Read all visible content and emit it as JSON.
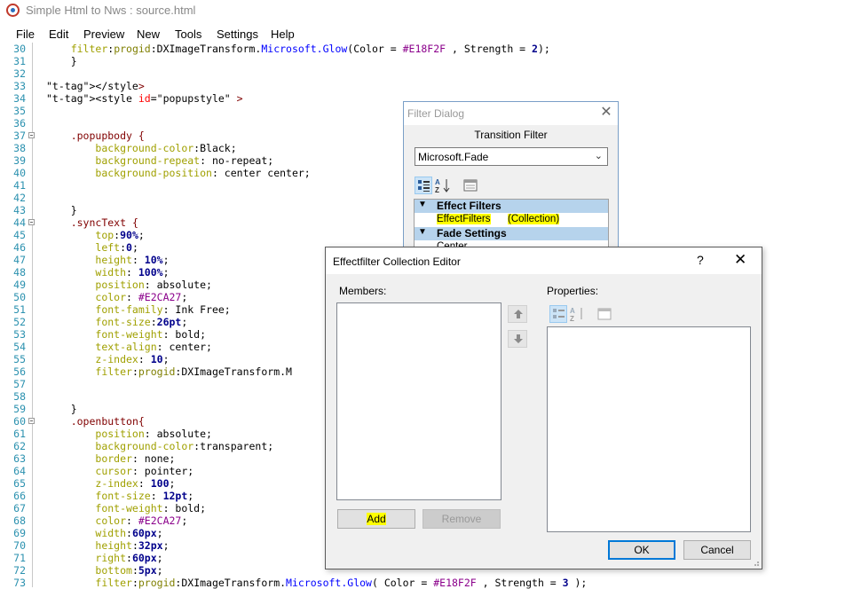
{
  "window": {
    "title": "Simple Html to Nws : source.html"
  },
  "menu": [
    {
      "label": "File"
    },
    {
      "label": "Edit"
    },
    {
      "label": "Preview"
    },
    {
      "label": "New"
    },
    {
      "label": "Tools"
    },
    {
      "label": "Settings"
    },
    {
      "label": "Help"
    }
  ],
  "editor": {
    "lines": [
      {
        "n": "30",
        "t": "    filter:progid:DXImageTransform.Microsoft.Glow(Color = #E18F2F , Strength = 2);"
      },
      {
        "n": "31",
        "t": "    }"
      },
      {
        "n": "32",
        "t": ""
      },
      {
        "n": "33",
        "t": "</style>"
      },
      {
        "n": "34",
        "t": "<style id=\"popupstyle\" >"
      },
      {
        "n": "35",
        "t": ""
      },
      {
        "n": "36",
        "t": ""
      },
      {
        "n": "37",
        "t": "    .popupbody {"
      },
      {
        "n": "38",
        "t": "        background-color:Black;"
      },
      {
        "n": "39",
        "t": "        background-repeat: no-repeat;"
      },
      {
        "n": "40",
        "t": "        background-position: center center;"
      },
      {
        "n": "41",
        "t": ""
      },
      {
        "n": "42",
        "t": ""
      },
      {
        "n": "43",
        "t": "    }"
      },
      {
        "n": "44",
        "t": "    .syncText {"
      },
      {
        "n": "45",
        "t": "        top:90%;"
      },
      {
        "n": "46",
        "t": "        left:0;"
      },
      {
        "n": "47",
        "t": "        height: 10%;"
      },
      {
        "n": "48",
        "t": "        width: 100%;"
      },
      {
        "n": "49",
        "t": "        position: absolute;"
      },
      {
        "n": "50",
        "t": "        color: #E2CA27;"
      },
      {
        "n": "51",
        "t": "        font-family: Ink Free;"
      },
      {
        "n": "52",
        "t": "        font-size:26pt;"
      },
      {
        "n": "53",
        "t": "        font-weight: bold;"
      },
      {
        "n": "54",
        "t": "        text-align: center;"
      },
      {
        "n": "55",
        "t": "        z-index: 10;"
      },
      {
        "n": "56",
        "t": "        filter:progid:DXImageTransform.M"
      },
      {
        "n": "57",
        "t": ""
      },
      {
        "n": "58",
        "t": ""
      },
      {
        "n": "59",
        "t": "    }"
      },
      {
        "n": "60",
        "t": "    .openbutton{"
      },
      {
        "n": "61",
        "t": "        position: absolute;"
      },
      {
        "n": "62",
        "t": "        background-color:transparent;"
      },
      {
        "n": "63",
        "t": "        border: none;"
      },
      {
        "n": "64",
        "t": "        cursor: pointer;"
      },
      {
        "n": "65",
        "t": "        z-index: 100;"
      },
      {
        "n": "66",
        "t": "        font-size: 12pt;"
      },
      {
        "n": "67",
        "t": "        font-weight: bold;"
      },
      {
        "n": "68",
        "t": "        color: #E2CA27;"
      },
      {
        "n": "69",
        "t": "        width:60px;"
      },
      {
        "n": "70",
        "t": "        height:32px;"
      },
      {
        "n": "71",
        "t": "        right:60px;"
      },
      {
        "n": "72",
        "t": "        bottom:5px;"
      },
      {
        "n": "73",
        "t": "        filter:progid:DXImageTransform.Microsoft.Glow( Color = #E18F2F , Strength = 3 );"
      }
    ]
  },
  "filter_dialog": {
    "title": "Filter Dialog",
    "label": "Transition Filter",
    "selected_filter": "Microsoft.Fade",
    "grid": {
      "cat1": "Effect Filters",
      "row1_name": "EffectFilters",
      "row1_value": "(Collection)",
      "cat2": "Fade Settings",
      "row2_name": "Center"
    }
  },
  "collection_editor": {
    "title": "Effectfilter Collection Editor",
    "help": "?",
    "members_label": "Members:",
    "properties_label": "Properties:",
    "add_label": "Add",
    "remove_label": "Remove",
    "ok_label": "OK",
    "cancel_label": "Cancel"
  },
  "colors": {
    "line_number": "#2b91af",
    "highlight": "#ffff00",
    "accent": "#0078d7"
  }
}
